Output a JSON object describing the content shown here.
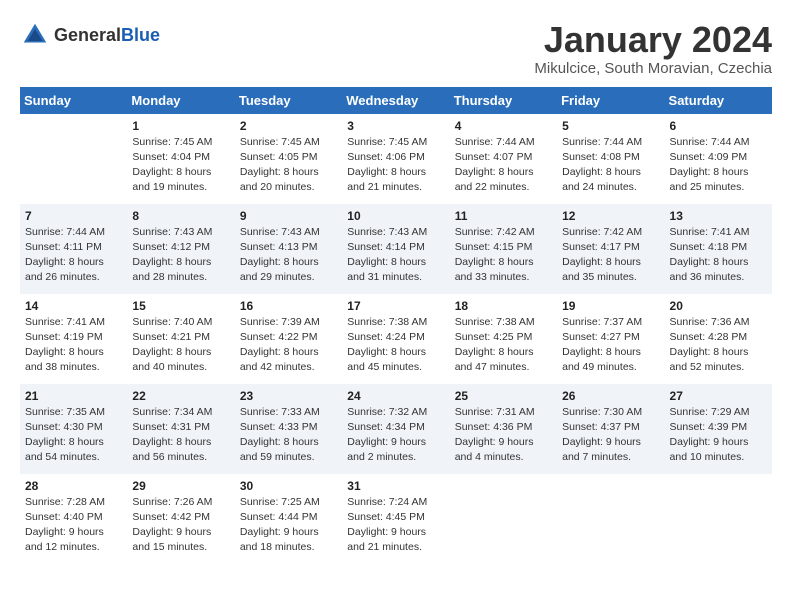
{
  "logo": {
    "general": "General",
    "blue": "Blue"
  },
  "title": "January 2024",
  "subtitle": "Mikulcice, South Moravian, Czechia",
  "days_header": [
    "Sunday",
    "Monday",
    "Tuesday",
    "Wednesday",
    "Thursday",
    "Friday",
    "Saturday"
  ],
  "weeks": [
    [
      {
        "num": "",
        "detail": ""
      },
      {
        "num": "1",
        "detail": "Sunrise: 7:45 AM\nSunset: 4:04 PM\nDaylight: 8 hours\nand 19 minutes."
      },
      {
        "num": "2",
        "detail": "Sunrise: 7:45 AM\nSunset: 4:05 PM\nDaylight: 8 hours\nand 20 minutes."
      },
      {
        "num": "3",
        "detail": "Sunrise: 7:45 AM\nSunset: 4:06 PM\nDaylight: 8 hours\nand 21 minutes."
      },
      {
        "num": "4",
        "detail": "Sunrise: 7:44 AM\nSunset: 4:07 PM\nDaylight: 8 hours\nand 22 minutes."
      },
      {
        "num": "5",
        "detail": "Sunrise: 7:44 AM\nSunset: 4:08 PM\nDaylight: 8 hours\nand 24 minutes."
      },
      {
        "num": "6",
        "detail": "Sunrise: 7:44 AM\nSunset: 4:09 PM\nDaylight: 8 hours\nand 25 minutes."
      }
    ],
    [
      {
        "num": "7",
        "detail": "Sunrise: 7:44 AM\nSunset: 4:11 PM\nDaylight: 8 hours\nand 26 minutes."
      },
      {
        "num": "8",
        "detail": "Sunrise: 7:43 AM\nSunset: 4:12 PM\nDaylight: 8 hours\nand 28 minutes."
      },
      {
        "num": "9",
        "detail": "Sunrise: 7:43 AM\nSunset: 4:13 PM\nDaylight: 8 hours\nand 29 minutes."
      },
      {
        "num": "10",
        "detail": "Sunrise: 7:43 AM\nSunset: 4:14 PM\nDaylight: 8 hours\nand 31 minutes."
      },
      {
        "num": "11",
        "detail": "Sunrise: 7:42 AM\nSunset: 4:15 PM\nDaylight: 8 hours\nand 33 minutes."
      },
      {
        "num": "12",
        "detail": "Sunrise: 7:42 AM\nSunset: 4:17 PM\nDaylight: 8 hours\nand 35 minutes."
      },
      {
        "num": "13",
        "detail": "Sunrise: 7:41 AM\nSunset: 4:18 PM\nDaylight: 8 hours\nand 36 minutes."
      }
    ],
    [
      {
        "num": "14",
        "detail": "Sunrise: 7:41 AM\nSunset: 4:19 PM\nDaylight: 8 hours\nand 38 minutes."
      },
      {
        "num": "15",
        "detail": "Sunrise: 7:40 AM\nSunset: 4:21 PM\nDaylight: 8 hours\nand 40 minutes."
      },
      {
        "num": "16",
        "detail": "Sunrise: 7:39 AM\nSunset: 4:22 PM\nDaylight: 8 hours\nand 42 minutes."
      },
      {
        "num": "17",
        "detail": "Sunrise: 7:38 AM\nSunset: 4:24 PM\nDaylight: 8 hours\nand 45 minutes."
      },
      {
        "num": "18",
        "detail": "Sunrise: 7:38 AM\nSunset: 4:25 PM\nDaylight: 8 hours\nand 47 minutes."
      },
      {
        "num": "19",
        "detail": "Sunrise: 7:37 AM\nSunset: 4:27 PM\nDaylight: 8 hours\nand 49 minutes."
      },
      {
        "num": "20",
        "detail": "Sunrise: 7:36 AM\nSunset: 4:28 PM\nDaylight: 8 hours\nand 52 minutes."
      }
    ],
    [
      {
        "num": "21",
        "detail": "Sunrise: 7:35 AM\nSunset: 4:30 PM\nDaylight: 8 hours\nand 54 minutes."
      },
      {
        "num": "22",
        "detail": "Sunrise: 7:34 AM\nSunset: 4:31 PM\nDaylight: 8 hours\nand 56 minutes."
      },
      {
        "num": "23",
        "detail": "Sunrise: 7:33 AM\nSunset: 4:33 PM\nDaylight: 8 hours\nand 59 minutes."
      },
      {
        "num": "24",
        "detail": "Sunrise: 7:32 AM\nSunset: 4:34 PM\nDaylight: 9 hours\nand 2 minutes."
      },
      {
        "num": "25",
        "detail": "Sunrise: 7:31 AM\nSunset: 4:36 PM\nDaylight: 9 hours\nand 4 minutes."
      },
      {
        "num": "26",
        "detail": "Sunrise: 7:30 AM\nSunset: 4:37 PM\nDaylight: 9 hours\nand 7 minutes."
      },
      {
        "num": "27",
        "detail": "Sunrise: 7:29 AM\nSunset: 4:39 PM\nDaylight: 9 hours\nand 10 minutes."
      }
    ],
    [
      {
        "num": "28",
        "detail": "Sunrise: 7:28 AM\nSunset: 4:40 PM\nDaylight: 9 hours\nand 12 minutes."
      },
      {
        "num": "29",
        "detail": "Sunrise: 7:26 AM\nSunset: 4:42 PM\nDaylight: 9 hours\nand 15 minutes."
      },
      {
        "num": "30",
        "detail": "Sunrise: 7:25 AM\nSunset: 4:44 PM\nDaylight: 9 hours\nand 18 minutes."
      },
      {
        "num": "31",
        "detail": "Sunrise: 7:24 AM\nSunset: 4:45 PM\nDaylight: 9 hours\nand 21 minutes."
      },
      {
        "num": "",
        "detail": ""
      },
      {
        "num": "",
        "detail": ""
      },
      {
        "num": "",
        "detail": ""
      }
    ]
  ]
}
